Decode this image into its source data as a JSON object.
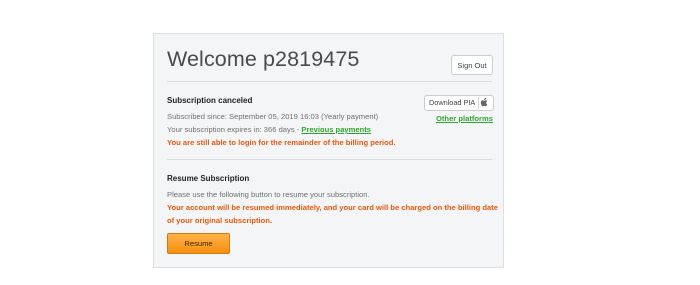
{
  "header": {
    "title": "Welcome p2819475",
    "sign_out_label": "Sign Out"
  },
  "subscription": {
    "heading": "Subscription canceled",
    "subscribed_since": "Subscribed since: September 05, 2019 16:03 (Yearly payment)",
    "expires_prefix": "Your subscription expires in: 366 days - ",
    "previous_payments_label": "Previous payments",
    "billing_notice": "You are still able to login for the remainder of the billing period."
  },
  "download": {
    "label": "Download PIA",
    "icon": "apple-icon",
    "other_platforms_label": "Other platforms"
  },
  "resume": {
    "heading": "Resume Subscription",
    "instructions": "Please use the following button to resume your subscription.",
    "warning_line1": "Your account will be resumed immediately, and your card will be charged on the billing date",
    "warning_line2": "of your original subscription.",
    "button_label": "Resume"
  },
  "colors": {
    "warning": "#e8560b",
    "link": "#2ea52e",
    "button": "#f5900f"
  }
}
